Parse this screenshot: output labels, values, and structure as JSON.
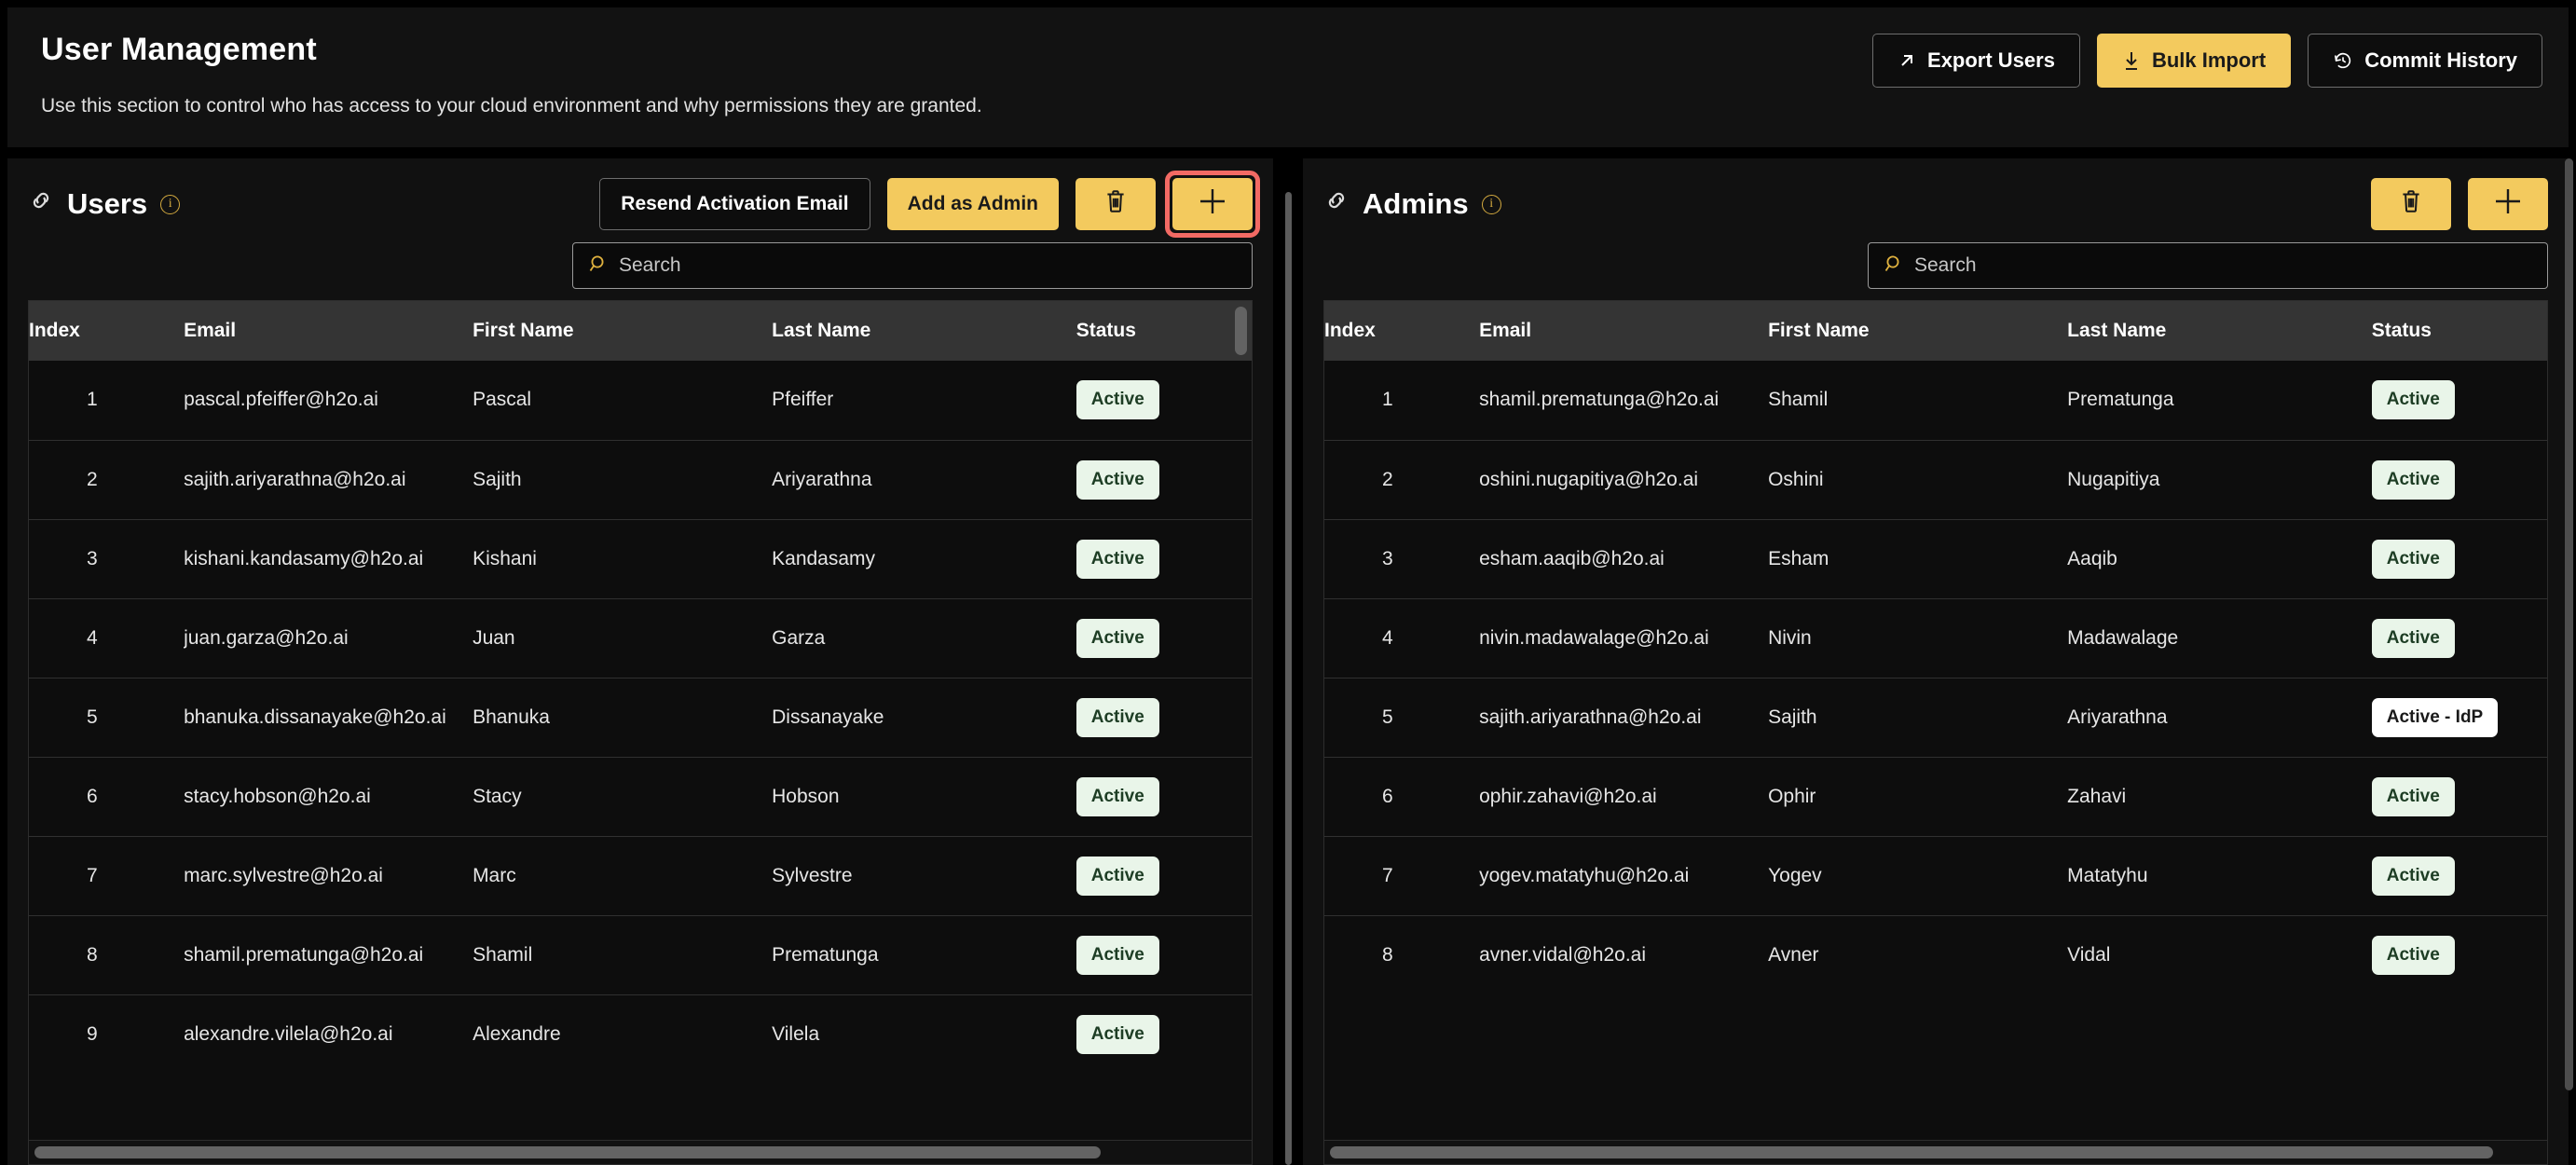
{
  "header": {
    "title": "User Management",
    "subtitle": "Use this section to control who has access to your cloud environment and why permissions they are granted.",
    "actions": [
      {
        "label": "Export Users",
        "icon": "arrow-up-right-icon",
        "style": "outline"
      },
      {
        "label": "Bulk Import",
        "icon": "download-arrow-icon",
        "style": "filled"
      },
      {
        "label": "Commit History",
        "icon": "history-clock-icon",
        "style": "outline"
      }
    ]
  },
  "colors": {
    "accent_yellow": "#f3ca5e",
    "highlight_red": "#f26a64",
    "badge_active_bg": "#e9f5e9",
    "badge_active_text": "#1d3d24",
    "badge_idp_bg": "#ffffff",
    "panel_bg": "#111111",
    "table_header_bg": "#343434",
    "page_bg": "#000000"
  },
  "users_panel": {
    "title": "Users",
    "title_icon": "link-chain-icon",
    "info_icon": "info-circle-icon",
    "buttons": [
      {
        "label": "Resend Activation Email",
        "style": "outline",
        "icon": null,
        "highlighted": false
      },
      {
        "label": "Add as Admin",
        "style": "filled",
        "icon": null,
        "highlighted": false
      },
      {
        "label": "",
        "style": "filled",
        "icon": "trash-icon",
        "highlighted": false
      },
      {
        "label": "",
        "style": "filled",
        "icon": "plus-icon",
        "highlighted": true
      }
    ],
    "search": {
      "placeholder": "Search",
      "value": "",
      "icon": "search-icon"
    },
    "columns": [
      "Index",
      "Email",
      "First Name",
      "Last Name",
      "Status"
    ],
    "rows": [
      {
        "index": "1",
        "email": "pascal.pfeiffer@h2o.ai",
        "first": "Pascal",
        "last": "Pfeiffer",
        "status": "Active"
      },
      {
        "index": "2",
        "email": "sajith.ariyarathna@h2o.ai",
        "first": "Sajith",
        "last": "Ariyarathna",
        "status": "Active"
      },
      {
        "index": "3",
        "email": "kishani.kandasamy@h2o.ai",
        "first": "Kishani",
        "last": "Kandasamy",
        "status": "Active"
      },
      {
        "index": "4",
        "email": "juan.garza@h2o.ai",
        "first": "Juan",
        "last": "Garza",
        "status": "Active"
      },
      {
        "index": "5",
        "email": "bhanuka.dissanayake@h2o.ai",
        "first": "Bhanuka",
        "last": "Dissanayake",
        "status": "Active"
      },
      {
        "index": "6",
        "email": "stacy.hobson@h2o.ai",
        "first": "Stacy",
        "last": "Hobson",
        "status": "Active"
      },
      {
        "index": "7",
        "email": "marc.sylvestre@h2o.ai",
        "first": "Marc",
        "last": "Sylvestre",
        "status": "Active"
      },
      {
        "index": "8",
        "email": "shamil.prematunga@h2o.ai",
        "first": "Shamil",
        "last": "Prematunga",
        "status": "Active"
      },
      {
        "index": "9",
        "email": "alexandre.vilela@h2o.ai",
        "first": "Alexandre",
        "last": "Vilela",
        "status": "Active"
      }
    ]
  },
  "admins_panel": {
    "title": "Admins",
    "title_icon": "link-chain-icon",
    "info_icon": "info-circle-icon",
    "buttons": [
      {
        "label": "",
        "style": "filled",
        "icon": "trash-icon",
        "highlighted": false
      },
      {
        "label": "",
        "style": "filled",
        "icon": "plus-icon",
        "highlighted": false
      }
    ],
    "search": {
      "placeholder": "Search",
      "value": "",
      "icon": "search-icon"
    },
    "columns": [
      "Index",
      "Email",
      "First Name",
      "Last Name",
      "Status"
    ],
    "rows": [
      {
        "index": "1",
        "email": "shamil.prematunga@h2o.ai",
        "first": "Shamil",
        "last": "Prematunga",
        "status": "Active"
      },
      {
        "index": "2",
        "email": "oshini.nugapitiya@h2o.ai",
        "first": "Oshini",
        "last": "Nugapitiya",
        "status": "Active"
      },
      {
        "index": "3",
        "email": "esham.aaqib@h2o.ai",
        "first": "Esham",
        "last": "Aaqib",
        "status": "Active"
      },
      {
        "index": "4",
        "email": "nivin.madawalage@h2o.ai",
        "first": "Nivin",
        "last": "Madawalage",
        "status": "Active"
      },
      {
        "index": "5",
        "email": "sajith.ariyarathna@h2o.ai",
        "first": "Sajith",
        "last": "Ariyarathna",
        "status": "Active - IdP"
      },
      {
        "index": "6",
        "email": "ophir.zahavi@h2o.ai",
        "first": "Ophir",
        "last": "Zahavi",
        "status": "Active"
      },
      {
        "index": "7",
        "email": "yogev.matatyhu@h2o.ai",
        "first": "Yogev",
        "last": "Matatyhu",
        "status": "Active"
      },
      {
        "index": "8",
        "email": "avner.vidal@h2o.ai",
        "first": "Avner",
        "last": "Vidal",
        "status": "Active"
      }
    ]
  }
}
